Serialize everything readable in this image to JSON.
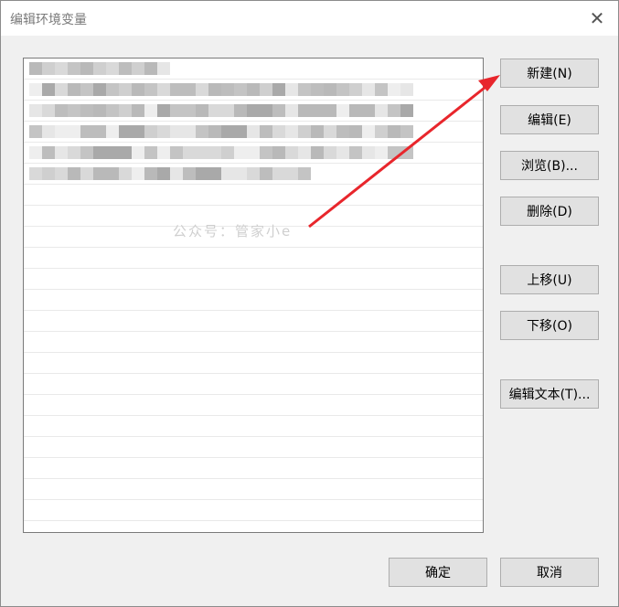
{
  "window": {
    "title": "编辑环境变量",
    "close_label": "✕"
  },
  "list": {
    "blurred_rows": 6,
    "watermark": "公众号：管家小e"
  },
  "buttons": {
    "new": "新建(N)",
    "edit": "编辑(E)",
    "browse": "浏览(B)...",
    "delete": "删除(D)",
    "move_up": "上移(U)",
    "move_down": "下移(O)",
    "edit_text": "编辑文本(T)...",
    "ok": "确定",
    "cancel": "取消"
  },
  "colors": {
    "arrow": "#e8262c"
  }
}
